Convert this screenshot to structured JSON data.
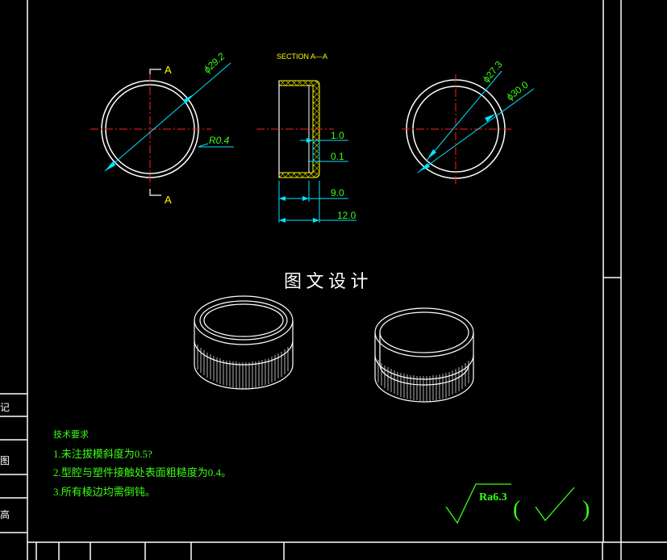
{
  "drawing": {
    "title_watermark": "图 文 设 计",
    "section_label": "SECTION A—A",
    "section_marker": "A",
    "front_view": {
      "diameter_label": "ϕ29.2",
      "radius_label": "R0.4"
    },
    "section_view": {
      "dim_wall": "1.0",
      "dim_gap": "0.1",
      "dim_inner_depth": "9.0",
      "dim_total_depth": "12.0"
    },
    "back_view": {
      "inner_diameter_label": "ϕ27.3",
      "outer_diameter_label": "ϕ30.0"
    },
    "tech_req": {
      "heading": "技术要求",
      "items": [
        "1.未注拔模斜度为0.5?",
        "2.型腔与塑件接触处表面粗糙度为0.4。",
        "3.所有棱边均需倒钝。"
      ]
    },
    "roughness": {
      "value": "Ra6.3",
      "paren_open": "(",
      "paren_close": ")"
    },
    "side_chars": [
      "记",
      "图",
      "高"
    ],
    "colors": {
      "background": "#000000",
      "outline": "#ffffff",
      "centerline": "#ff0000",
      "dimension": "#00ffff",
      "text": "#39ff14",
      "section": "#ffff00"
    }
  }
}
